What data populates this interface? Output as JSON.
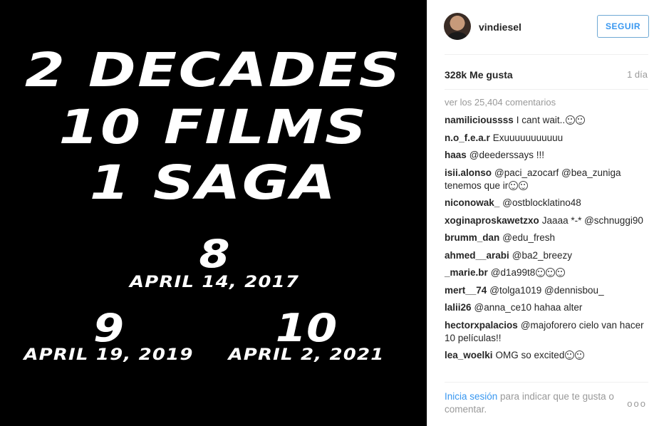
{
  "poster": {
    "line1": "2 DECADES",
    "line2": "10 FILMS",
    "line3": "1 SAGA",
    "films": [
      {
        "num": "8",
        "date": "APRIL 14, 2017"
      },
      {
        "num": "9",
        "date": "APRIL 19, 2019"
      },
      {
        "num": "10",
        "date": "APRIL 2, 2021"
      }
    ]
  },
  "header": {
    "username": "vindiesel",
    "follow_label": "SEGUIR"
  },
  "stats": {
    "likes": "328k Me gusta",
    "time": "1 día"
  },
  "view_all": "ver los 25,404 comentarios",
  "comments": [
    {
      "user": "namilicioussss",
      "text": "I cant wait..",
      "emoji_count": 2
    },
    {
      "user": "n.o_f.e.a.r",
      "text": "Exuuuuuuuuuuu",
      "emoji_count": 0
    },
    {
      "user": "haas",
      "text": "@deederssays !!!",
      "emoji_count": 0
    },
    {
      "user": "isii.alonso",
      "text": "@paci_azocarf @bea_zuniga tenemos que ir",
      "emoji_count": 2
    },
    {
      "user": "niconowak_",
      "text": "@ostblocklatino48",
      "emoji_count": 0
    },
    {
      "user": "xoginaproskawetzxo",
      "text": "Jaaaa *-* @schnuggi90",
      "emoji_count": 0
    },
    {
      "user": "brumm_dan",
      "text": "@edu_fresh",
      "emoji_count": 0
    },
    {
      "user": "ahmed__arabi",
      "text": "@ba2_breezy",
      "emoji_count": 0
    },
    {
      "user": "_marie.br",
      "text": "@d1a99t8",
      "emoji_count": 3
    },
    {
      "user": "mert__74",
      "text": "@tolga1019 @dennisbou_",
      "emoji_count": 0
    },
    {
      "user": "lalii26",
      "text": "@anna_ce10 hahaa alter",
      "emoji_count": 0
    },
    {
      "user": "hectorxpalacios",
      "text": "@majoforero cielo van hacer 10 películas!!",
      "emoji_count": 0
    },
    {
      "user": "lea_woelki",
      "text": "OMG so excited",
      "emoji_count": 2
    }
  ],
  "footer": {
    "login_link": "Inicia sesión",
    "prompt_rest": " para indicar que te gusta o comentar.",
    "more": "ooo"
  },
  "colors": {
    "link_blue": "#3897f0",
    "muted": "#999999",
    "poster_bg": "#000000"
  },
  "icons": {
    "more": "more-options-icon",
    "emoji": "smiley-emoji-icon"
  }
}
